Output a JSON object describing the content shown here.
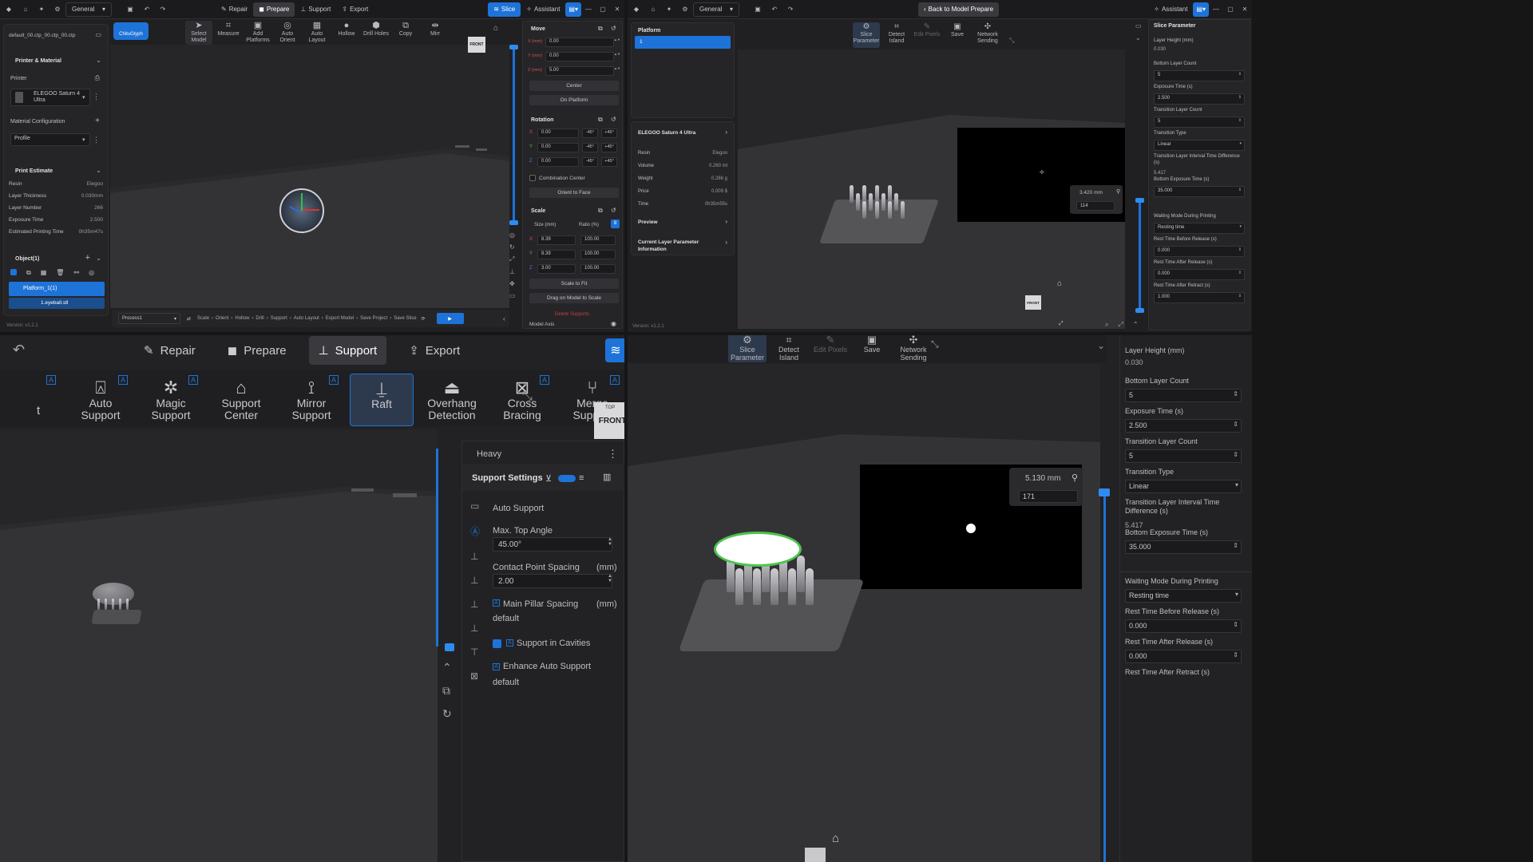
{
  "q1": {
    "top": {
      "general": "General",
      "repair": "Repair",
      "prepare": "Prepare",
      "support": "Support",
      "export": "Export",
      "slice": "Slice",
      "assistant": "Assistant"
    },
    "filename": "default_00.ctp_00.ctp_00.ctp",
    "chitu": "ChituGlyph",
    "tools": [
      "Select Model",
      "Measure",
      "Add Platforms",
      "Auto Orient",
      "Auto Layout",
      "Hollow",
      "Drill Holes",
      "Copy",
      "Mirr"
    ],
    "printer_material": "Printer & Material",
    "printer_label": "Printer",
    "printer_name": "ELEGOO Saturn 4 Ultra",
    "material_config": "Material Configuration",
    "profile": "Profile",
    "print_estimate": "Print Estimate",
    "estimate": [
      [
        "Resin",
        "Elegoo"
      ],
      [
        "Layer Thickness",
        "0.030mm"
      ],
      [
        "Layer Number",
        "266"
      ],
      [
        "Exposure Time",
        "2.500"
      ],
      [
        "Estimated Printing Time",
        "0h35m47s"
      ]
    ],
    "objects": "Object(1)",
    "platform": "Platform_1(1)",
    "file": "1.eyeball.stl",
    "version": "Version: v1.2.1",
    "process": "Process1",
    "pipeline": [
      "Scale",
      "Orient",
      "Hollow",
      "Drill",
      "Support",
      "Auto Layout",
      "Export Model",
      "Save Project",
      "Save Slice"
    ],
    "front": "FRONT",
    "move": "Move",
    "move_vals": [
      [
        "X (mm)",
        "0.00"
      ],
      [
        "Y (mm)",
        "0.00"
      ],
      [
        "Z (mm)",
        "5.00"
      ]
    ],
    "center": "Center",
    "on_platform": "On Platform",
    "rotation": "Rotation",
    "rot_vals": [
      [
        "X",
        "0.00"
      ],
      [
        "Y",
        "0.00"
      ],
      [
        "Z",
        "0.00"
      ]
    ],
    "minus45": "-45°",
    "plus45": "+45°",
    "combination": "Combination Center",
    "orient_face": "Orient to Face",
    "scale": "Scale",
    "size_mm": "Size (mm)",
    "ratio": "Ratio (%)",
    "scale_vals": [
      [
        "X",
        "8.39",
        "100.00"
      ],
      [
        "Y",
        "8.39",
        "100.00"
      ],
      [
        "Z",
        "3.00",
        "100.00"
      ]
    ],
    "scale_fit": "Scale to Fit",
    "drag_scale": "Drag on Model to Scale",
    "delete_supports": "Delete Supports",
    "model_axis": "Model Axis"
  },
  "q2": {
    "general": "General",
    "back": "Back to Model Prepare",
    "assistant": "Assistant",
    "platform_title": "Platform",
    "platform_item": "1",
    "printer": "ELEGOO Saturn 4 Ultra",
    "info": [
      [
        "Resin",
        "Elegoo"
      ],
      [
        "Volume",
        "0.260 ml"
      ],
      [
        "Weight",
        "0.286 g"
      ],
      [
        "Price",
        "0.009 $"
      ],
      [
        "Time",
        "0h35m55s"
      ]
    ],
    "preview": "Preview",
    "current_layer": "Current Layer Parameter Information",
    "tools": [
      "Slice Parameter",
      "Detect Island",
      "Edit Pixels",
      "Save",
      "Network Sending"
    ],
    "height": "3.420 mm",
    "layer": "114",
    "front": "FRONT",
    "version": "Version: v1.2.1",
    "slice_param": "Slice Parameter",
    "params": [
      [
        "Layer Height (mm)",
        "0.030",
        false
      ],
      [
        "Bottom Layer Count",
        "5",
        true
      ],
      [
        "Exposure Time (s)",
        "2.500",
        true
      ],
      [
        "Transition Layer Count",
        "5",
        true
      ],
      [
        "Transition Type",
        "Linear",
        true
      ],
      [
        "Transition Layer Interval Time Difference (s)",
        "5.417",
        false
      ],
      [
        "Bottom Exposure Time (s)",
        "35.000",
        true
      ],
      [
        "Waiting Mode During Printing",
        "Resting time",
        true
      ],
      [
        "Rest Time Before Release  (s)",
        "0.000",
        true
      ],
      [
        "Rest Time After Release  (s)",
        "0.000",
        true
      ],
      [
        "Rest Time After Retract  (s)",
        "1.000",
        true
      ]
    ]
  },
  "q3": {
    "tabs": [
      "Repair",
      "Prepare",
      "Support",
      "Export"
    ],
    "tools": [
      "Auto Support",
      "Magic Support",
      "Support Center",
      "Mirror Support",
      "Raft",
      "Overhang Detection",
      "Cross Bracing",
      "Merge Support"
    ],
    "cut": "t",
    "badge": "A",
    "front": "FRONT",
    "top": "TOP",
    "heavy": "Heavy",
    "settings_title": "Support Settings",
    "auto_support": "Auto Support",
    "max_top_angle": "Max. Top Angle",
    "angle_val": "45.00°",
    "contact_spacing": "Contact Point Spacing",
    "mm": "(mm)",
    "contact_val": "2.00",
    "pillar_spacing": "Main Pillar Spacing",
    "pillar_val": "default",
    "cavities": "Support in Cavities",
    "enhance": "Enhance Auto Support",
    "enhance_val": "default"
  },
  "q4": {
    "tools": [
      "Slice Parameter",
      "Detect Island",
      "Edit Pixels",
      "Save",
      "Network Sending"
    ],
    "height": "5.130 mm",
    "layer": "171",
    "params": [
      [
        "Layer Height (mm)",
        "0.030",
        false
      ],
      [
        "Bottom Layer Count",
        "5",
        true
      ],
      [
        "Exposure Time (s)",
        "2.500",
        true
      ],
      [
        "Transition Layer Count",
        "5",
        true
      ],
      [
        "Transition Type",
        "Linear",
        true
      ],
      [
        "Transition Layer Interval Time Difference (s)",
        "5.417",
        false
      ],
      [
        "Bottom Exposure Time (s)",
        "35.000",
        true
      ],
      [
        "Waiting Mode During Printing",
        "Resting time",
        true
      ],
      [
        "Rest Time Before Release  (s)",
        "0.000",
        true
      ],
      [
        "Rest Time After Release  (s)",
        "0.000",
        true
      ],
      [
        "Rest Time After Retract  (s)",
        null,
        false
      ]
    ]
  },
  "colors": {
    "accent": "#1e73d8",
    "bg": "#202022",
    "panel": "#252528"
  }
}
